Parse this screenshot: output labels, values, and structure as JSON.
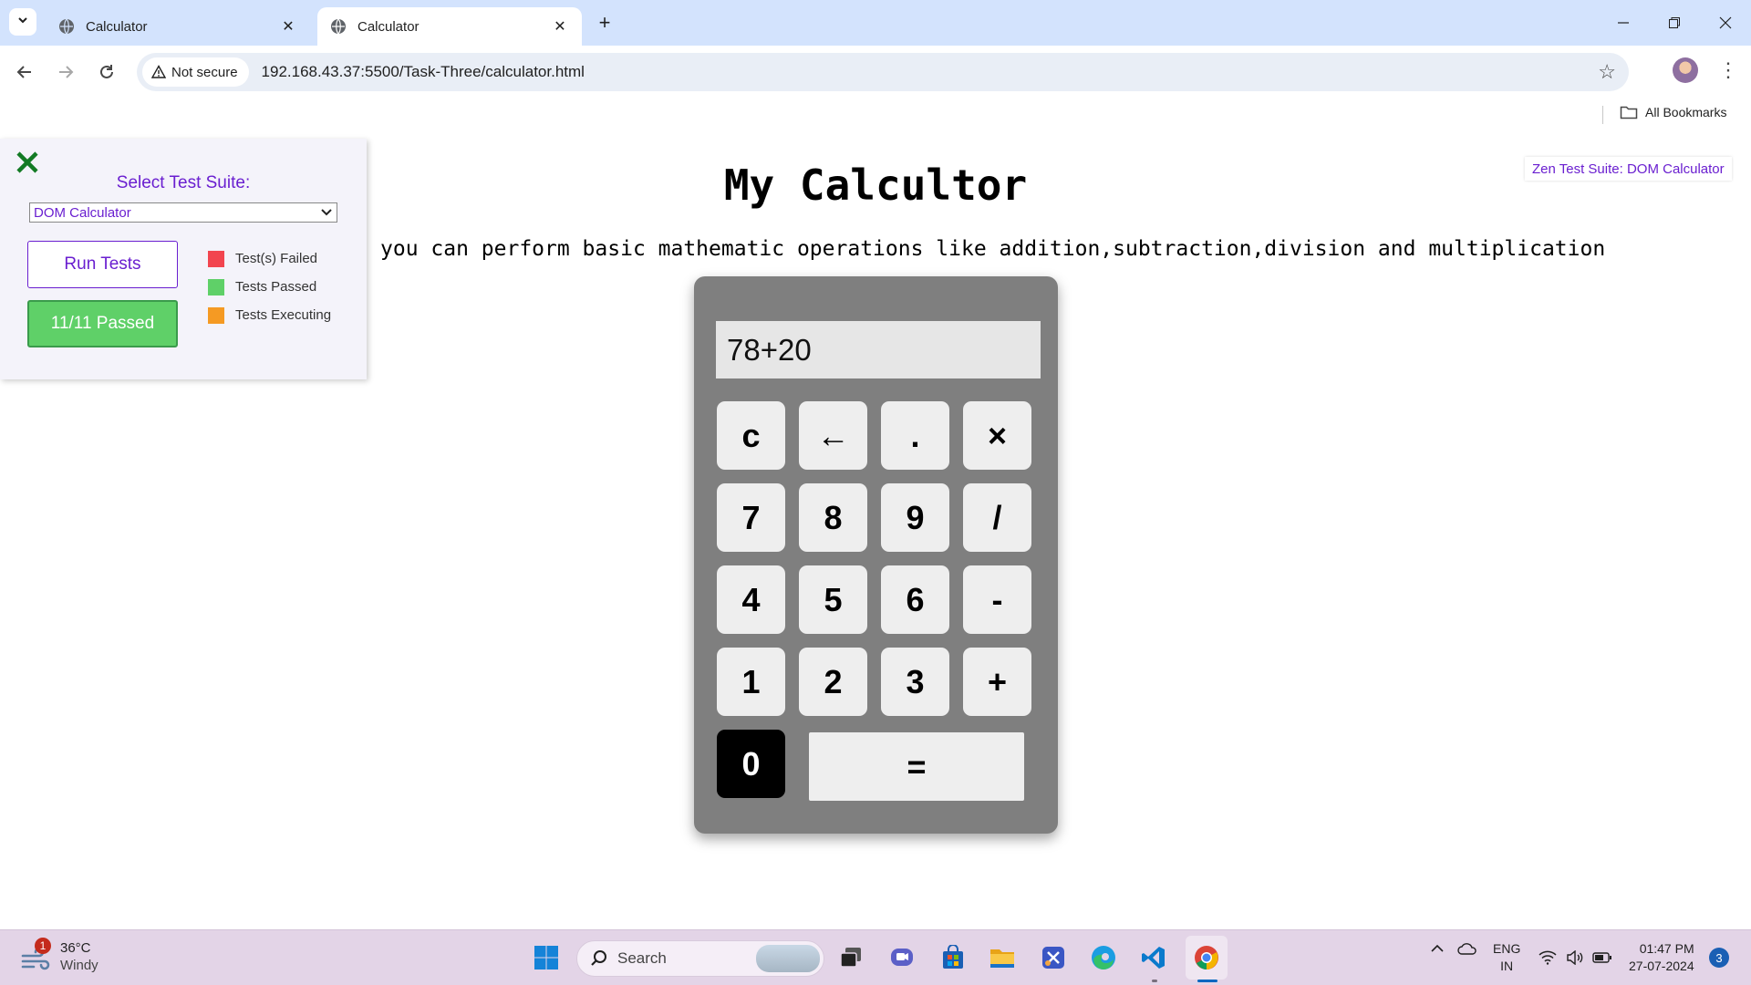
{
  "browser": {
    "tabs": [
      {
        "title": "Calculator",
        "active": false
      },
      {
        "title": "Calculator",
        "active": true
      }
    ],
    "security_label": "Not secure",
    "url": "192.168.43.37:5500/Task-Three/calculator.html",
    "bookmarks": {
      "all_label": "All Bookmarks"
    }
  },
  "page": {
    "title": "My Calcultor",
    "subtitle": "you can perform basic mathematic operations like addition,subtraction,division and multiplication",
    "zen_badge": "Zen Test Suite: DOM Calculator"
  },
  "test_suite": {
    "label": "Select Test Suite:",
    "selected": "DOM Calculator",
    "run_label": "Run Tests",
    "result_label": "11/11 Passed",
    "legend": [
      {
        "label": "Test(s) Failed",
        "color": "#f2454f"
      },
      {
        "label": "Tests Passed",
        "color": "#5fd068"
      },
      {
        "label": "Tests Executing",
        "color": "#f59a23"
      }
    ]
  },
  "calculator": {
    "display": "78+20",
    "keys": {
      "clear": "c",
      "backspace": "←",
      "dot": ".",
      "multiply": "×",
      "seven": "7",
      "eight": "8",
      "nine": "9",
      "divide": "/",
      "four": "4",
      "five": "5",
      "six": "6",
      "minus": "-",
      "one": "1",
      "two": "2",
      "three": "3",
      "plus": "+",
      "zero": "0",
      "equals": "="
    }
  },
  "taskbar": {
    "weather_temp": "36°C",
    "weather_desc": "Windy",
    "weather_badge": "1",
    "search_placeholder": "Search",
    "lang_top": "ENG",
    "lang_bottom": "IN",
    "time": "01:47 PM",
    "date": "27-07-2024",
    "notifications": "3"
  }
}
